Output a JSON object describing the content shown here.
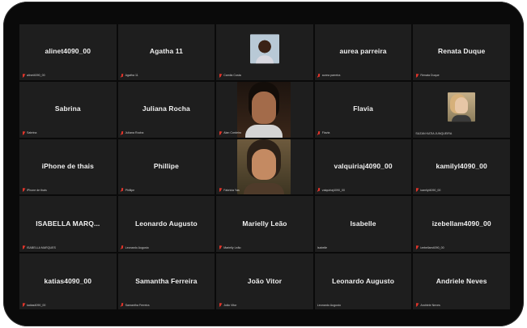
{
  "participants": [
    {
      "display": "alinet4090_00",
      "label": "alinet4090_00",
      "muted": true,
      "video": null
    },
    {
      "display": "Agatha 11",
      "label": "Agatha 11",
      "muted": true,
      "video": null
    },
    {
      "display": "",
      "label": "Camila Costa",
      "muted": true,
      "video": "photo-small-a"
    },
    {
      "display": "aurea parreira",
      "label": "aurea parreira",
      "muted": true,
      "video": null
    },
    {
      "display": "Renata Duque",
      "label": "Renata Duque",
      "muted": true,
      "video": null
    },
    {
      "display": "Sabrina",
      "label": "Sabrina",
      "muted": true,
      "video": null
    },
    {
      "display": "Juliana Rocha",
      "label": "Juliana Rocha",
      "muted": true,
      "video": null
    },
    {
      "display": "",
      "label": "Alan Cordeiro",
      "muted": true,
      "video": "photo-big-c"
    },
    {
      "display": "Flavia",
      "label": "Flavia",
      "muted": true,
      "video": null
    },
    {
      "display": "",
      "label": "SUZAN KATIA JUNQUEIRA",
      "muted": false,
      "video": "photo-small-b"
    },
    {
      "display": "iPhone de thais",
      "label": "iPhone de thais",
      "muted": true,
      "video": null
    },
    {
      "display": "Phillipe",
      "label": "Phillipe",
      "muted": true,
      "video": null
    },
    {
      "display": "",
      "label": "Fabricia Yas",
      "muted": true,
      "video": "photo-big-d"
    },
    {
      "display": "valquiriaj4090_00",
      "label": "valquiriaj4090_00",
      "muted": true,
      "video": null
    },
    {
      "display": "kamilyl4090_00",
      "label": "kamilyl4090_00",
      "muted": true,
      "video": null
    },
    {
      "display": "ISABELLA  MARQ...",
      "label": "ISABELLA MARQUES",
      "muted": true,
      "video": null
    },
    {
      "display": "Leonardo Augusto",
      "label": "Leonardo Augusto",
      "muted": true,
      "video": null
    },
    {
      "display": "Marielly Leão",
      "label": "Marielly Leão",
      "muted": true,
      "video": null
    },
    {
      "display": "Isabelle",
      "label": "Isabelle",
      "muted": false,
      "video": null
    },
    {
      "display": "izebellam4090_00",
      "label": "izebellam4090_00",
      "muted": true,
      "video": null
    },
    {
      "display": "katias4090_00",
      "label": "katias4090_00",
      "muted": true,
      "video": null
    },
    {
      "display": "Samantha Ferreira",
      "label": "Samantha Ferreira",
      "muted": true,
      "video": null
    },
    {
      "display": "João Vitor",
      "label": "João Vitor",
      "muted": true,
      "video": null
    },
    {
      "display": "Leonardo Augusto",
      "label": "Leonardo Augusto",
      "muted": false,
      "video": null
    },
    {
      "display": "Andriele Neves",
      "label": "Andriele Neves",
      "muted": true,
      "video": null
    }
  ],
  "icons": {
    "muted": "mic-off-icon"
  },
  "colors": {
    "tile_bg": "#1e1e1e",
    "frame_bg": "#0a0a0a",
    "muted_icon": "#e0352b"
  }
}
